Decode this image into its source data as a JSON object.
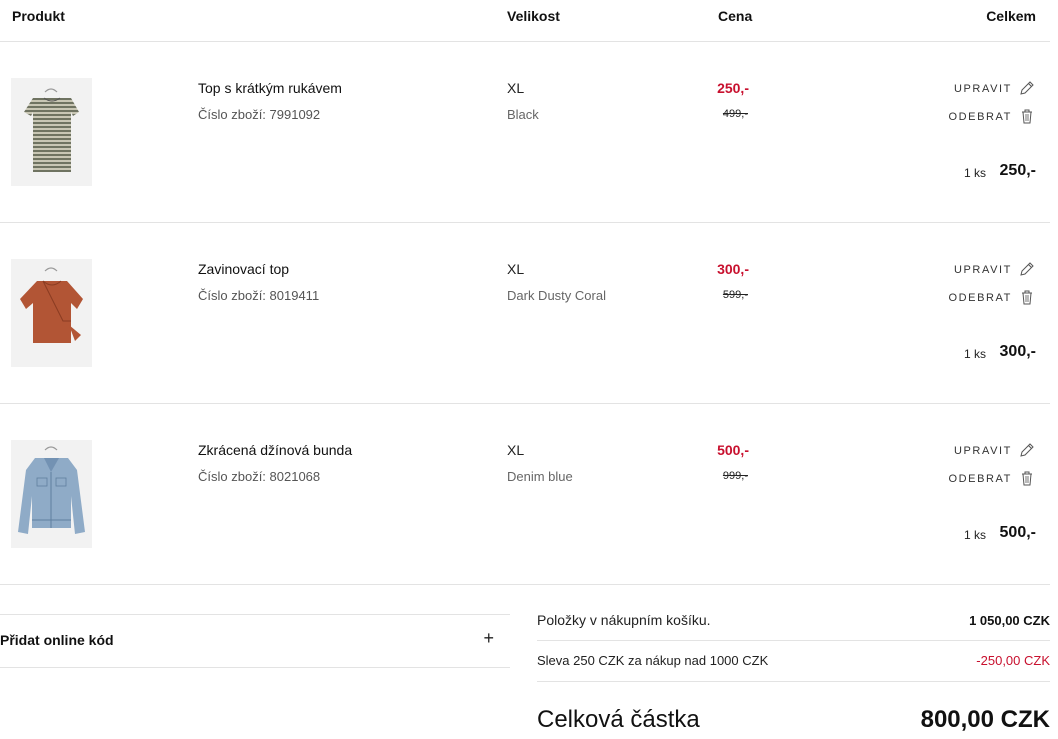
{
  "headers": {
    "product": "Produkt",
    "size": "Velikost",
    "price": "Cena",
    "total": "Celkem"
  },
  "items": [
    {
      "name": "Top s krátkým rukávem",
      "code": "Číslo zboží: 7991092",
      "size": "XL",
      "color": "Black",
      "price_new": "250,-",
      "price_old": "499,-",
      "edit_label": "UPRAVIT",
      "remove_label": "ODEBRAT",
      "qty": "1 ks",
      "total": "250,-",
      "image_icon": "striped-tshirt-icon",
      "swatch": "#7f826f"
    },
    {
      "name": "Zavinovací top",
      "code": "Číslo zboží: 8019411",
      "size": "XL",
      "color": "Dark Dusty Coral",
      "price_new": "300,-",
      "price_old": "599,-",
      "edit_label": "UPRAVIT",
      "remove_label": "ODEBRAT",
      "qty": "1 ks",
      "total": "300,-",
      "image_icon": "wrap-top-icon",
      "swatch": "#b4583a"
    },
    {
      "name": "Zkrácená džínová bunda",
      "code": "Číslo zboží: 8021068",
      "size": "XL",
      "color": "Denim blue",
      "price_new": "500,-",
      "price_old": "999,-",
      "edit_label": "UPRAVIT",
      "remove_label": "ODEBRAT",
      "qty": "1 ks",
      "total": "500,-",
      "image_icon": "denim-jacket-icon",
      "swatch": "#8eaac6"
    }
  ],
  "promo": {
    "label": "Přidat online kód",
    "icon": "plus-icon",
    "symbol": "+"
  },
  "summary": {
    "items_label": "Položky v nákupním košíku.",
    "items_value": "1 050,00 CZK",
    "discount_label": "Sleva 250 CZK za nákup nad 1000 CZK",
    "discount_value": "-250,00 CZK",
    "grand_label": "Celková částka",
    "grand_value": "800,00 CZK"
  },
  "colors": {
    "sale_red": "#c8102e",
    "divider": "#e3e3e3"
  }
}
